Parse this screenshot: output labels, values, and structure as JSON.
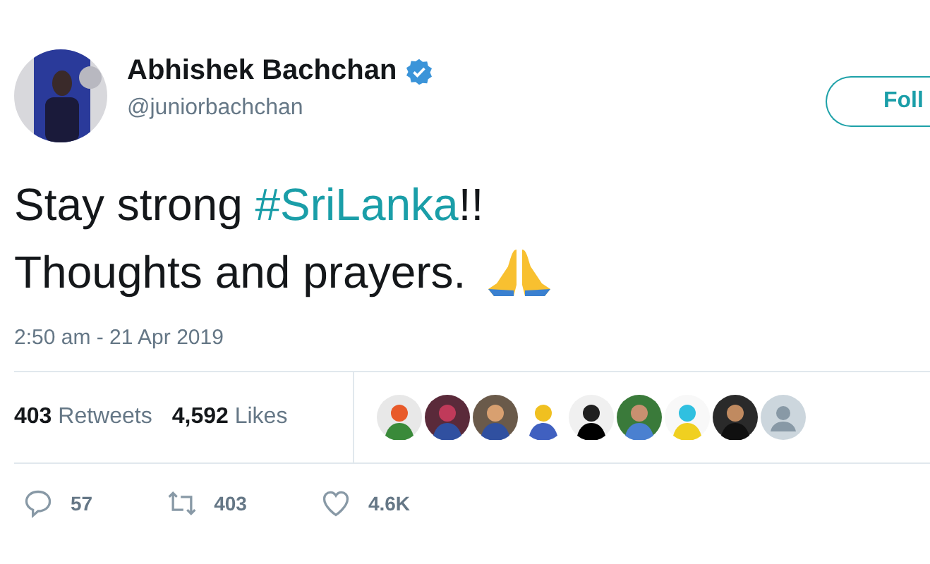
{
  "author": {
    "name": "Abhishek Bachchan",
    "verified": true,
    "handle": "@juniorbachchan"
  },
  "follow_button": {
    "label": "Foll"
  },
  "tweet_lines": [
    {
      "parts": [
        {
          "text": "Stay strong ",
          "kind": "plain"
        },
        {
          "text": "#SriLanka",
          "kind": "hashtag"
        },
        {
          "text": "!!",
          "kind": "plain"
        }
      ]
    },
    {
      "parts": [
        {
          "text": "Thoughts and prayers.",
          "kind": "plain"
        },
        {
          "kind": "praying-hands"
        }
      ]
    }
  ],
  "timestamp": "2:50 am - 21 Apr 2019",
  "stats": [
    {
      "count": "403",
      "label": "Retweets"
    },
    {
      "count": "4,592",
      "label": "Likes"
    }
  ],
  "liker_avatars": [
    {
      "kind": "picture"
    },
    {
      "kind": "picture"
    },
    {
      "kind": "picture"
    },
    {
      "kind": "picture"
    },
    {
      "kind": "picture"
    },
    {
      "kind": "picture"
    },
    {
      "kind": "picture"
    },
    {
      "kind": "picture"
    },
    {
      "kind": "default"
    }
  ],
  "actions": [
    {
      "kind": "reply",
      "count": "57"
    },
    {
      "kind": "retweet",
      "count": "403"
    },
    {
      "kind": "like",
      "count": "4.6K"
    }
  ]
}
